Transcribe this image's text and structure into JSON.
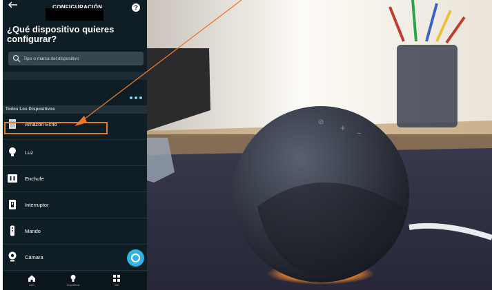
{
  "phone": {
    "header_title": "CONFIGURACIÓN",
    "help_label": "?",
    "page_title": "¿Qué dispositivo quieres configurar?",
    "search": {
      "placeholder": "Tipo o marca del dispositivo",
      "value": ""
    },
    "section_header": "Todos Los Dispositivos",
    "devices": [
      {
        "label": "Amazon Echo",
        "icon": "echo-speaker-icon"
      },
      {
        "label": "Luz",
        "icon": "light-bulb-icon"
      },
      {
        "label": "Enchufe",
        "icon": "plug-icon"
      },
      {
        "label": "Interruptor",
        "icon": "switch-icon"
      },
      {
        "label": "Mando",
        "icon": "remote-icon"
      },
      {
        "label": "Cámara",
        "icon": "camera-icon"
      }
    ],
    "bottom_nav": [
      {
        "label": "Inicio",
        "icon": "home-icon"
      },
      {
        "label": "Dispositivos",
        "icon": "devices-icon"
      },
      {
        "label": "Más",
        "icon": "more-grid-icon"
      }
    ]
  },
  "colors": {
    "app_background": "#0f1d24",
    "accent": "#2fb4e6",
    "annotation": "#e8782a",
    "echo_ring_light": "#ff8c2a"
  }
}
